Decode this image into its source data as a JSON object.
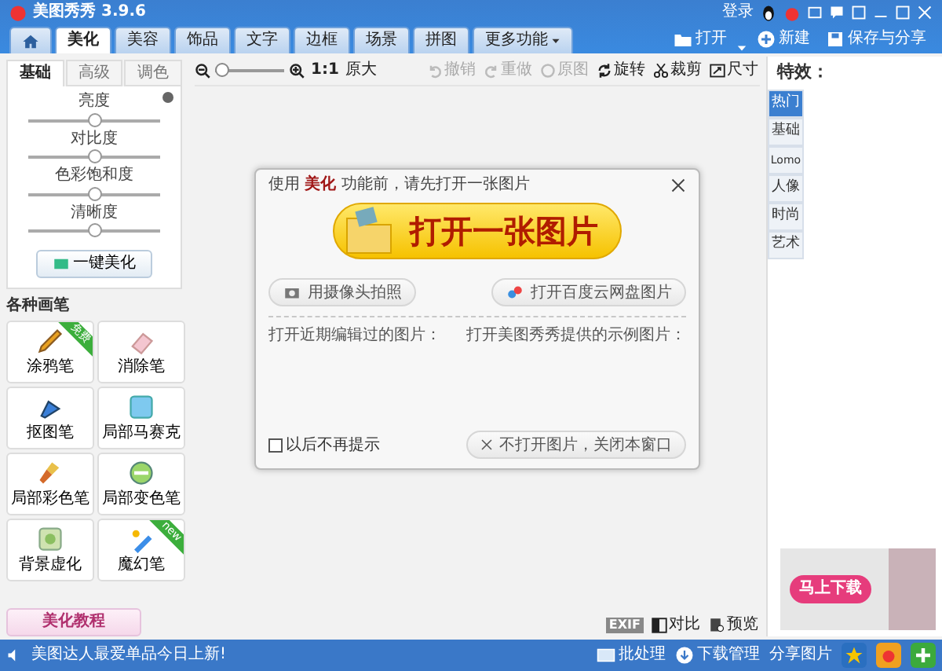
{
  "window": {
    "title": "美图秀秀 3.9.6",
    "login": "登录"
  },
  "tabs": [
    {
      "label": "美化",
      "selected": true
    },
    {
      "label": "美容",
      "selected": false
    },
    {
      "label": "饰品",
      "selected": false
    },
    {
      "label": "文字",
      "selected": false
    },
    {
      "label": "边框",
      "selected": false
    },
    {
      "label": "场景",
      "selected": false
    },
    {
      "label": "拼图",
      "selected": false
    }
  ],
  "more_tab": {
    "label": "更多功能"
  },
  "file_actions": [
    {
      "kind": "open",
      "label": "打开"
    },
    {
      "kind": "new",
      "label": "新建"
    },
    {
      "kind": "save",
      "label": "保存与分享"
    }
  ],
  "sidebar": {
    "subtabs": [
      {
        "label": "基础",
        "selected": true
      },
      {
        "label": "高级",
        "selected": false
      },
      {
        "label": "调色",
        "selected": false
      }
    ],
    "sliders": [
      {
        "label": "亮度",
        "level": 0.5
      },
      {
        "label": "对比度",
        "level": 0.5
      },
      {
        "label": "色彩饱和度",
        "level": 0.5
      },
      {
        "label": "清晰度",
        "level": 0.5
      }
    ],
    "auto_button": "一键美化",
    "brushes_title": "各种画笔",
    "brushes": [
      {
        "label": "涂鸦笔",
        "kind": "pencil",
        "badge": "免费"
      },
      {
        "label": "消除笔",
        "kind": "eraser"
      },
      {
        "label": "抠图笔",
        "kind": "pen"
      },
      {
        "label": "局部马赛克",
        "kind": "mosaic"
      },
      {
        "label": "局部彩色笔",
        "kind": "brush"
      },
      {
        "label": "局部变色笔",
        "kind": "bucket"
      },
      {
        "label": "背景虚化",
        "kind": "blur"
      },
      {
        "label": "魔幻笔",
        "kind": "magic",
        "badge": "new"
      }
    ],
    "tutorial_button": "美化教程"
  },
  "toolbar": {
    "zoom_label": "1:1",
    "zoom_text": "原大",
    "zoom_slider": {
      "level": 0.0
    },
    "actions": [
      {
        "kind": "undo",
        "label": "撤销",
        "disabled": true
      },
      {
        "kind": "redo",
        "label": "重做",
        "disabled": true
      },
      {
        "kind": "original",
        "label": "原图",
        "disabled": true
      },
      {
        "kind": "rotate",
        "label": "旋转",
        "disabled": false
      },
      {
        "kind": "crop",
        "label": "裁剪",
        "disabled": false
      },
      {
        "kind": "resize",
        "label": "尺寸",
        "disabled": false
      }
    ]
  },
  "dialog": {
    "message": "使用 **美化** 功能前，请先打开一张图片",
    "open_button": "打开一张图片",
    "camera_button": "用摄像头拍照",
    "cloud_button": "打开百度云网盘图片",
    "recent_label": "打开近期编辑过的图片：",
    "samples_label": "打开美图秀秀提供的示例图片：",
    "dont_show": {
      "label": "以后不再提示",
      "checked": false
    },
    "close_button": "不打开图片，关闭本窗口"
  },
  "canvas_footer": {
    "exif": "EXIF",
    "compare": "对比",
    "preview": "预览"
  },
  "effects": {
    "title": "特效：",
    "categories": [
      {
        "label": "热门",
        "selected": true
      },
      {
        "label": "基础",
        "selected": false
      },
      {
        "label": "Lomo",
        "selected": false
      },
      {
        "label": "人像",
        "selected": false
      },
      {
        "label": "时尚",
        "selected": false
      },
      {
        "label": "艺术",
        "selected": false
      }
    ],
    "ad_button": "马上下载"
  },
  "status_bar": {
    "message": "美图达人最爱单品今日上新!",
    "actions": [
      {
        "kind": "batch",
        "label": "批处理"
      },
      {
        "kind": "download",
        "label": "下载管理"
      },
      {
        "kind": "share",
        "label": "分享图片"
      }
    ]
  }
}
